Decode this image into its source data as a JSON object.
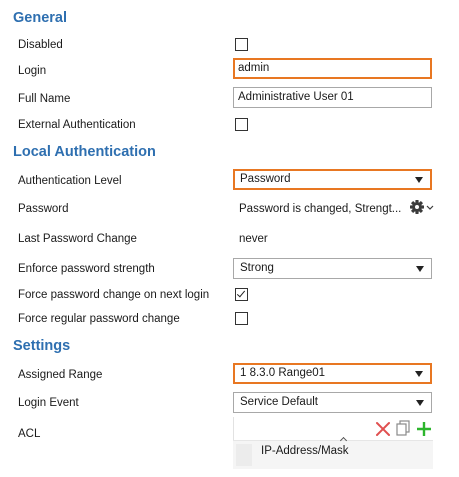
{
  "sections": {
    "general": "General",
    "local_auth": "Local Authentication",
    "settings": "Settings"
  },
  "general": {
    "disabled_label": "Disabled",
    "disabled_checked": false,
    "login_label": "Login",
    "login_value": "admin",
    "full_name_label": "Full Name",
    "full_name_value": "Administrative User 01",
    "external_auth_label": "External Authentication",
    "external_auth_checked": false
  },
  "local_auth": {
    "auth_level_label": "Authentication Level",
    "auth_level_value": "Password",
    "password_label": "Password",
    "password_value": "Password is changed, Strengt...",
    "last_change_label": "Last Password Change",
    "last_change_value": "never",
    "enforce_label": "Enforce password strength",
    "enforce_value": "Strong",
    "force_next_label": "Force password change on next login",
    "force_next_checked": true,
    "force_regular_label": "Force regular password change",
    "force_regular_checked": false
  },
  "settings": {
    "assigned_range_label": "Assigned Range",
    "assigned_range_value": "1 8.3.0 Range01",
    "login_event_label": "Login Event",
    "login_event_value": "Service Default",
    "acl_label": "ACL",
    "acl_column_header": "IP-Address/Mask"
  },
  "colors": {
    "section_heading": "#2e6fb0",
    "focus_border": "#e87722",
    "delete_icon": "#e05050",
    "add_icon": "#2db52d"
  },
  "icons": [
    "gear-icon",
    "chevron-down-icon",
    "dropdown-arrow-icon",
    "checkmark-icon",
    "delete-icon",
    "copy-icon",
    "add-icon",
    "sort-up-icon"
  ]
}
